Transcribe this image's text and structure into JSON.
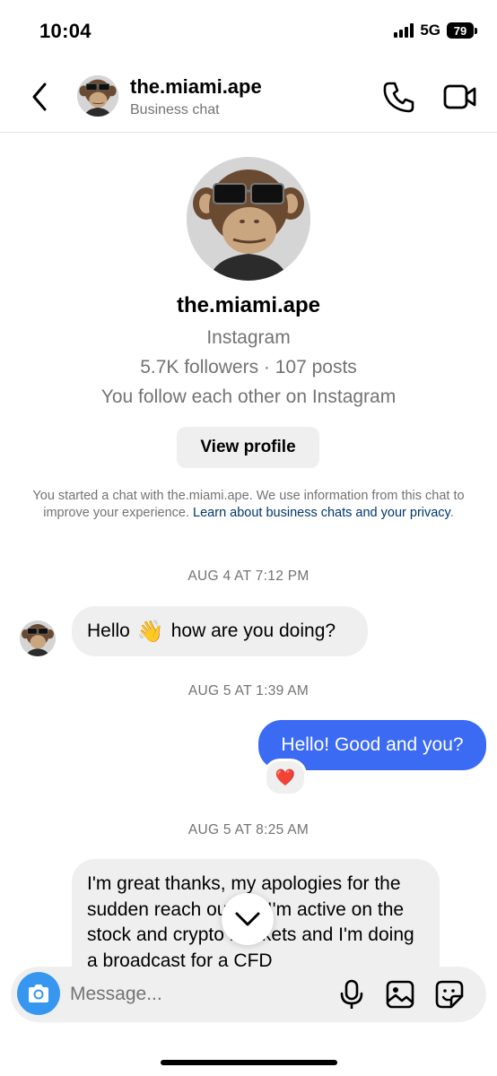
{
  "status_bar": {
    "time": "10:04",
    "network": "5G",
    "battery": "79"
  },
  "header": {
    "name": "the.miami.ape",
    "subtitle": "Business chat",
    "icons": {
      "back": "chevron-left-icon",
      "call": "phone-icon",
      "video": "video-camera-icon"
    }
  },
  "profile": {
    "name": "the.miami.ape",
    "platform": "Instagram",
    "stats": "5.7K followers · 107 posts",
    "mutual": "You follow each other on Instagram",
    "view_profile_label": "View profile"
  },
  "notice": {
    "text": "You started a chat with the.miami.ape. We use information from this chat to improve your experience. ",
    "link": "Learn about business chats and your privacy",
    "end": "."
  },
  "messages": [
    {
      "timestamp": "AUG 4 AT 7:12 PM",
      "direction": "incoming",
      "text_before": "Hello",
      "emoji": "👋",
      "text_after": "how are you doing?"
    },
    {
      "timestamp": "AUG 5 AT 1:39 AM",
      "direction": "outgoing",
      "text": "Hello! Good and you?",
      "reaction": "❤️"
    },
    {
      "timestamp": "AUG 5 AT 8:25 AM",
      "direction": "incoming",
      "text": "I'm great thanks, my apologies for the sudden reach out lol. I'm active on the stock and crypto markets and I'm doing a broadcast for a CFD"
    }
  ],
  "composer": {
    "placeholder": "Message...",
    "icons": [
      "camera-icon",
      "microphone-icon",
      "image-icon",
      "sticker-icon"
    ]
  },
  "colors": {
    "outgoing_bubble": "#3b6af3",
    "incoming_bubble": "#efefef",
    "link": "#00376b",
    "camera_button": "#3797f0",
    "secondary_text": "#737373"
  }
}
